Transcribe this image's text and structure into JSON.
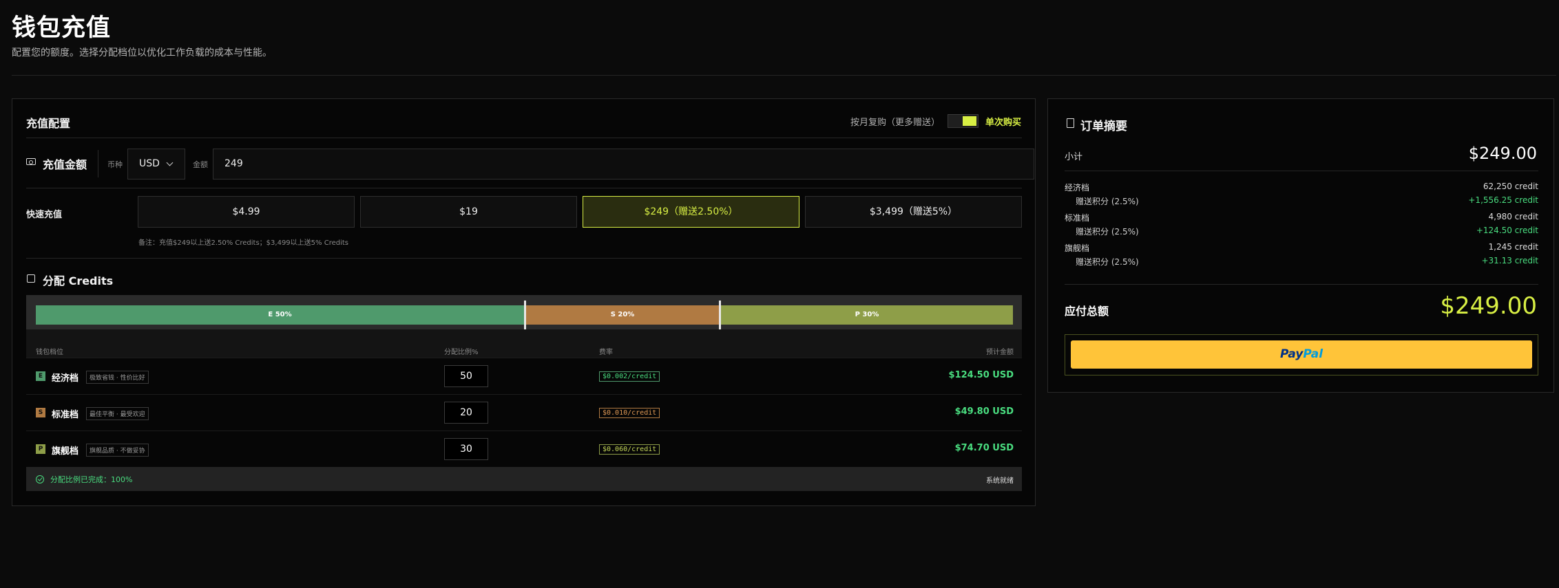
{
  "page": {
    "title": "钱包充值",
    "subtitle": "配置您的额度。选择分配档位以优化工作负载的成本与性能。"
  },
  "config": {
    "title": "充值配置",
    "mode_label": "按月复购（更多赠送）",
    "mode_active": "单次购买",
    "amount_section_title": "充值金额",
    "currency_label": "币种",
    "currency_value": "USD",
    "amount_label": "金额",
    "amount_value": "249",
    "quick_label": "快速充值",
    "quick_options": [
      "$4.99",
      "$19",
      "$249（赠送2.50%）",
      "$3,499（赠送5%）"
    ],
    "quick_selected_index": 2,
    "note": "备注：充值$249以上送2.50% Credits；$3,499以上送5% Credits"
  },
  "allocation": {
    "title": "分配 Credits",
    "segments": [
      {
        "label": "E 50%",
        "percent": 50,
        "color": "#4f9a6c"
      },
      {
        "label": "S 20%",
        "percent": 20,
        "color": "#b07a42"
      },
      {
        "label": "P 30%",
        "percent": 30,
        "color": "#8e9e48"
      }
    ],
    "headers": {
      "tier": "钱包档位",
      "ratio": "分配比例%",
      "rate": "费率",
      "estimate": "预计金额"
    },
    "rows": [
      {
        "badge": "E",
        "name": "经济档",
        "tag": "极致省钱 · 性价比好",
        "ratio": "50",
        "rate": "$0.002/credit",
        "amount": "$124.50 USD",
        "color": "#4f9a6c"
      },
      {
        "badge": "S",
        "name": "标准档",
        "tag": "最佳平衡 · 最受欢迎",
        "ratio": "20",
        "rate": "$0.010/credit",
        "amount": "$49.80 USD",
        "color": "#b07a42"
      },
      {
        "badge": "P",
        "name": "旗舰档",
        "tag": "旗舰品质 · 不做妥协",
        "ratio": "30",
        "rate": "$0.060/credit",
        "amount": "$74.70 USD",
        "color": "#8e9e48"
      }
    ],
    "status_text": "分配比例已完成：100%",
    "system_status": "系统就绪"
  },
  "summary": {
    "title": "订单摘要",
    "subtotal_label": "小计",
    "subtotal_value": "$249.00",
    "items": [
      {
        "name": "经济档",
        "credits": "62,250 credit",
        "bonus_label": "赠送积分 (2.5%)",
        "bonus": "+1,556.25 credit"
      },
      {
        "name": "标准档",
        "credits": "4,980 credit",
        "bonus_label": "赠送积分 (2.5%)",
        "bonus": "+124.50 credit"
      },
      {
        "name": "旗舰档",
        "credits": "1,245 credit",
        "bonus_label": "赠送积分 (2.5%)",
        "bonus": "+31.13 credit"
      }
    ],
    "total_label": "应付总额",
    "total_value": "$249.00",
    "paypal_part1": "Pay",
    "paypal_part2": "Pal"
  },
  "colors": {
    "accent": "#d8ef44",
    "positive": "#4ade80",
    "paypal": "#ffc439"
  }
}
